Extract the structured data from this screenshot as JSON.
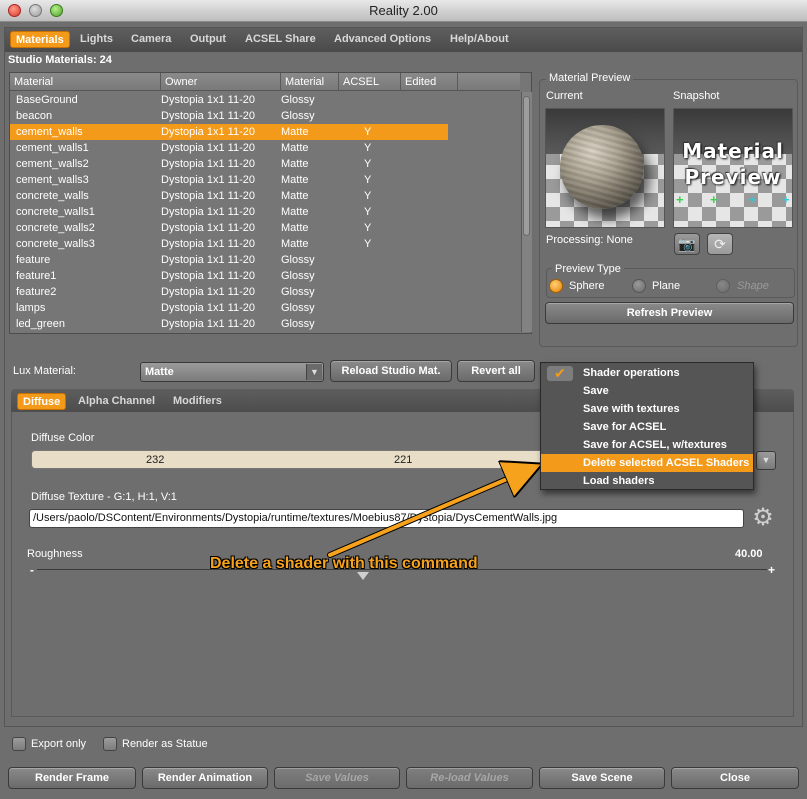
{
  "window": {
    "title": "Reality  2.00"
  },
  "tabs": [
    "Materials",
    "Lights",
    "Camera",
    "Output",
    "ACSEL Share",
    "Advanced Options",
    "Help/About"
  ],
  "studio_materials_label": "Studio Materials: 24",
  "table": {
    "headers": [
      "Material",
      "Owner",
      "Material",
      "ACSEL",
      "Edited"
    ],
    "rows": [
      {
        "material": "BaseGround",
        "owner": "Dystopia 1x1 11-20",
        "type": "Glossy",
        "acsel": "",
        "edited": ""
      },
      {
        "material": "beacon",
        "owner": "Dystopia 1x1 11-20",
        "type": "Glossy",
        "acsel": "",
        "edited": ""
      },
      {
        "material": "cement_walls",
        "owner": "Dystopia 1x1 11-20",
        "type": "Matte",
        "acsel": "Y",
        "edited": ""
      },
      {
        "material": "cement_walls1",
        "owner": "Dystopia 1x1 11-20",
        "type": "Matte",
        "acsel": "Y",
        "edited": ""
      },
      {
        "material": "cement_walls2",
        "owner": "Dystopia 1x1 11-20",
        "type": "Matte",
        "acsel": "Y",
        "edited": ""
      },
      {
        "material": "cement_walls3",
        "owner": "Dystopia 1x1 11-20",
        "type": "Matte",
        "acsel": "Y",
        "edited": ""
      },
      {
        "material": "concrete_walls",
        "owner": "Dystopia 1x1 11-20",
        "type": "Matte",
        "acsel": "Y",
        "edited": ""
      },
      {
        "material": "concrete_walls1",
        "owner": "Dystopia 1x1 11-20",
        "type": "Matte",
        "acsel": "Y",
        "edited": ""
      },
      {
        "material": "concrete_walls2",
        "owner": "Dystopia 1x1 11-20",
        "type": "Matte",
        "acsel": "Y",
        "edited": ""
      },
      {
        "material": "concrete_walls3",
        "owner": "Dystopia 1x1 11-20",
        "type": "Matte",
        "acsel": "Y",
        "edited": ""
      },
      {
        "material": "feature",
        "owner": "Dystopia 1x1 11-20",
        "type": "Glossy",
        "acsel": "",
        "edited": ""
      },
      {
        "material": "feature1",
        "owner": "Dystopia 1x1 11-20",
        "type": "Glossy",
        "acsel": "",
        "edited": ""
      },
      {
        "material": "feature2",
        "owner": "Dystopia 1x1 11-20",
        "type": "Glossy",
        "acsel": "",
        "edited": ""
      },
      {
        "material": "lamps",
        "owner": "Dystopia 1x1 11-20",
        "type": "Glossy",
        "acsel": "",
        "edited": ""
      },
      {
        "material": "led_green",
        "owner": "Dystopia 1x1 11-20",
        "type": "Glossy",
        "acsel": "",
        "edited": ""
      }
    ],
    "selected_index": 2
  },
  "preview": {
    "group_title": "Material Preview",
    "current_label": "Current",
    "snapshot_label": "Snapshot",
    "snapshot_text_line1": "Material",
    "snapshot_text_line2": "Preview",
    "processing": "Processing: None",
    "preview_type_title": "Preview Type",
    "options": [
      "Sphere",
      "Plane",
      "Shape"
    ],
    "selected_option": "Sphere",
    "refresh_label": "Refresh Preview"
  },
  "lux": {
    "label": "Lux Material:",
    "value": "Matte",
    "reload_label": "Reload Studio Mat.",
    "revert_label": "Revert all"
  },
  "menu": {
    "items": [
      "Shader operations",
      "Save",
      "Save with textures",
      "Save for ACSEL",
      "Save for ACSEL, w/textures",
      "Delete selected ACSEL Shaders",
      "Load shaders"
    ],
    "highlighted_index": 5
  },
  "subtabs": [
    "Diffuse",
    "Alpha Channel",
    "Modifiers"
  ],
  "diffuse": {
    "color_label": "Diffuse Color",
    "r": "232",
    "g": "221",
    "texture_label": "Diffuse Texture - G:1, H:1, V:1",
    "texture_path": "/Users/paolo/DSContent/Environments/Dystopia/runtime/textures/Moebius87/Dystopia/DysCementWalls.jpg",
    "roughness_label": "Roughness",
    "roughness_value": "40.00",
    "minus": "-",
    "plus": "+"
  },
  "callout": "Delete a shader with this command",
  "options": {
    "export_only": "Export only",
    "render_as_statue": "Render as Statue"
  },
  "bottom_buttons": [
    "Render Frame",
    "Render Animation",
    "Save Values",
    "Re-load Values",
    "Save Scene",
    "Close"
  ],
  "colors": {
    "accent": "#f39a1a",
    "panel": "#6e6e6e"
  }
}
